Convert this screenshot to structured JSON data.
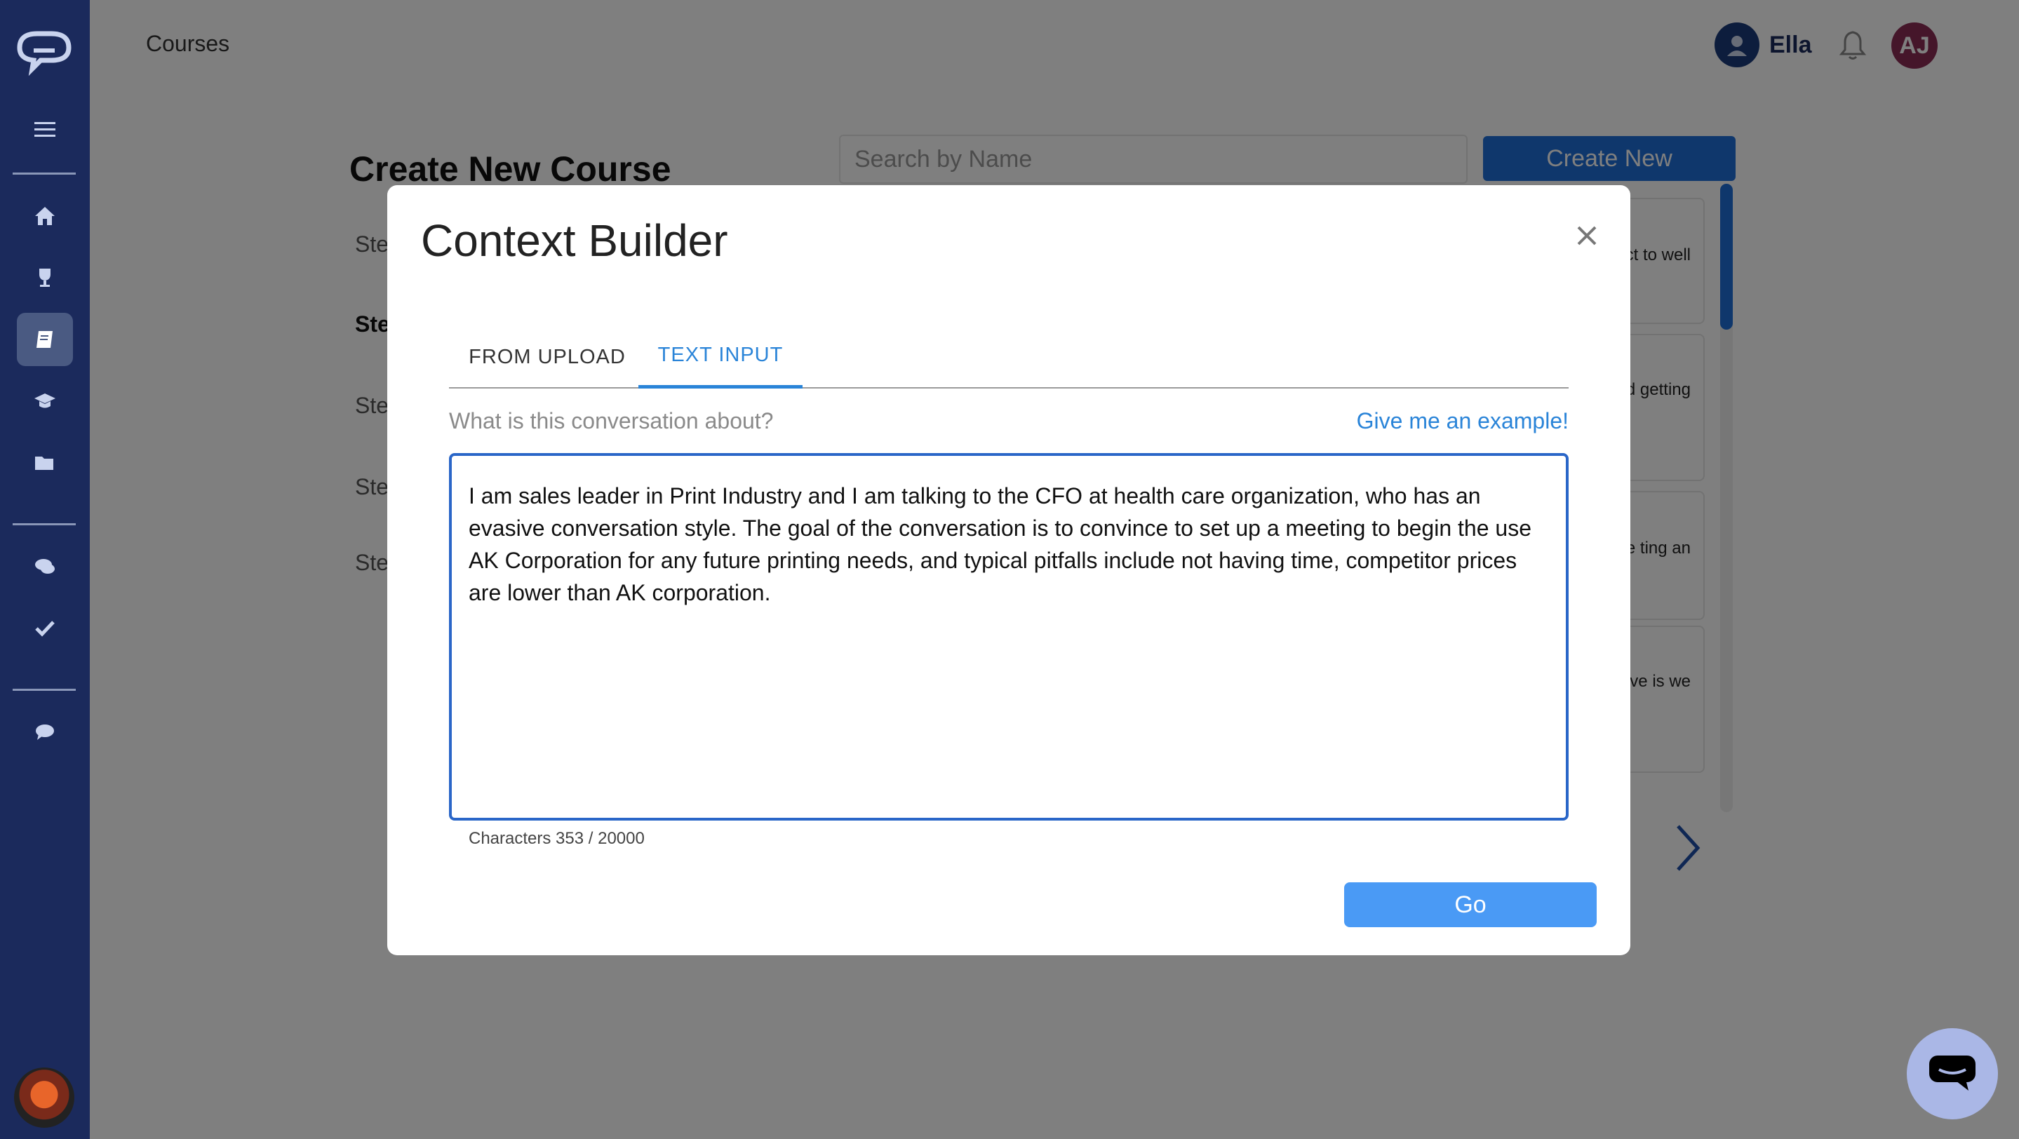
{
  "header": {
    "title": "Courses",
    "user_name": "Ella",
    "avatar_initials": "AJ"
  },
  "page": {
    "heading": "Create New Course",
    "steps": [
      "Ste",
      "Ste",
      "Ste",
      "Ste",
      "Ste"
    ],
    "search_placeholder": "Search by Name",
    "create_new_label": "Create New",
    "cards": [
      {
        "text": "act to well"
      },
      {
        "text": "ticulate tand getting"
      },
      {
        "text": "nd sale ting an"
      },
      {
        "text": "ctive is we"
      }
    ]
  },
  "modal": {
    "title": "Context Builder",
    "tabs": [
      {
        "label": "FROM UPLOAD",
        "active": false
      },
      {
        "label": "TEXT INPUT",
        "active": true
      }
    ],
    "question": "What is this conversation about?",
    "example_link": "Give me an example!",
    "text_value": "I am sales leader in Print Industry and I am talking to the CFO at health care organization, who has an evasive conversation style. The goal of the conversation is to convince to set up a meeting to begin the use AK Corporation for any future printing needs, and typical pitfalls include not having time, competitor prices are lower than AK corporation.",
    "char_count": "Characters 353 / 20000",
    "go_label": "Go"
  },
  "colors": {
    "sidebar": "#1b2a5c",
    "accent": "#2a84d8",
    "go_button": "#4a9af5",
    "avatar_aj": "#8a2d55"
  },
  "icons": [
    "logo-icon",
    "menu-icon",
    "home-icon",
    "trophy-icon",
    "book-icon",
    "graduation-cap-icon",
    "folder-icon",
    "chat-icon",
    "check-icon",
    "comment-icon",
    "bell-icon",
    "close-icon",
    "chevron-right-icon"
  ]
}
